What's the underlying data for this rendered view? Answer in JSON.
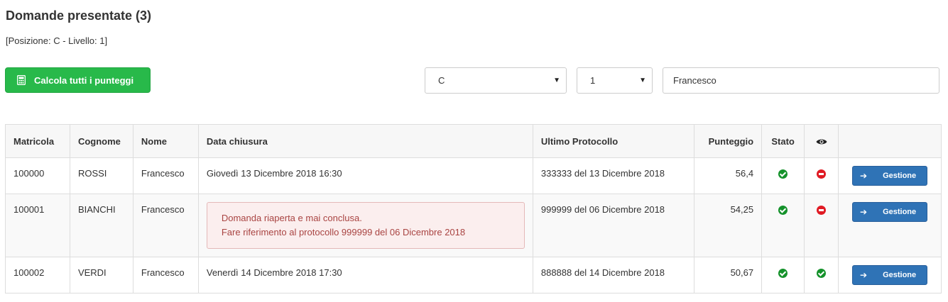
{
  "header": {
    "title": "Domande presentate (3)",
    "subtitle": "[Posizione: C - Livello: 1]"
  },
  "toolbar": {
    "calc_label": "Calcola tutti i punteggi",
    "posizione_value": "C",
    "livello_value": "1",
    "search_value": "Francesco"
  },
  "table": {
    "headers": {
      "matricola": "Matricola",
      "cognome": "Cognome",
      "nome": "Nome",
      "data": "Data chiusura",
      "protocollo": "Ultimo Protocollo",
      "punteggio": "Punteggio",
      "stato": "Stato"
    },
    "rows": [
      {
        "matricola": "100000",
        "cognome": "ROSSI",
        "nome": "Francesco",
        "data": "Giovedì 13 Dicembre 2018 16:30",
        "protocollo": "333333 del 13 Dicembre 2018",
        "punteggio": "56,4",
        "stato": "ok",
        "visibile": "no",
        "action": "Gestione"
      },
      {
        "matricola": "100001",
        "cognome": "BIANCHI",
        "nome": "Francesco",
        "alert_line1": "Domanda riaperta e mai conclusa.",
        "alert_line2": "Fare riferimento al protocollo 999999 del 06 Dicembre 2018",
        "protocollo": "999999 del 06 Dicembre 2018",
        "punteggio": "54,25",
        "stato": "ok",
        "visibile": "no",
        "action": "Gestione"
      },
      {
        "matricola": "100002",
        "cognome": "VERDI",
        "nome": "Francesco",
        "data": "Venerdì 14 Dicembre 2018 17:30",
        "protocollo": "888888 del 14 Dicembre 2018",
        "punteggio": "50,67",
        "stato": "ok",
        "visibile": "ok",
        "action": "Gestione"
      }
    ]
  },
  "colors": {
    "calc_button": "#28b94a",
    "action_button": "#2f73b6",
    "status_ok": "#15922b",
    "status_no": "#e01b24",
    "alert_text": "#a94442"
  },
  "icons": {
    "calc": "calculator-icon",
    "view": "eye-icon",
    "action": "arrow-right-icon"
  }
}
